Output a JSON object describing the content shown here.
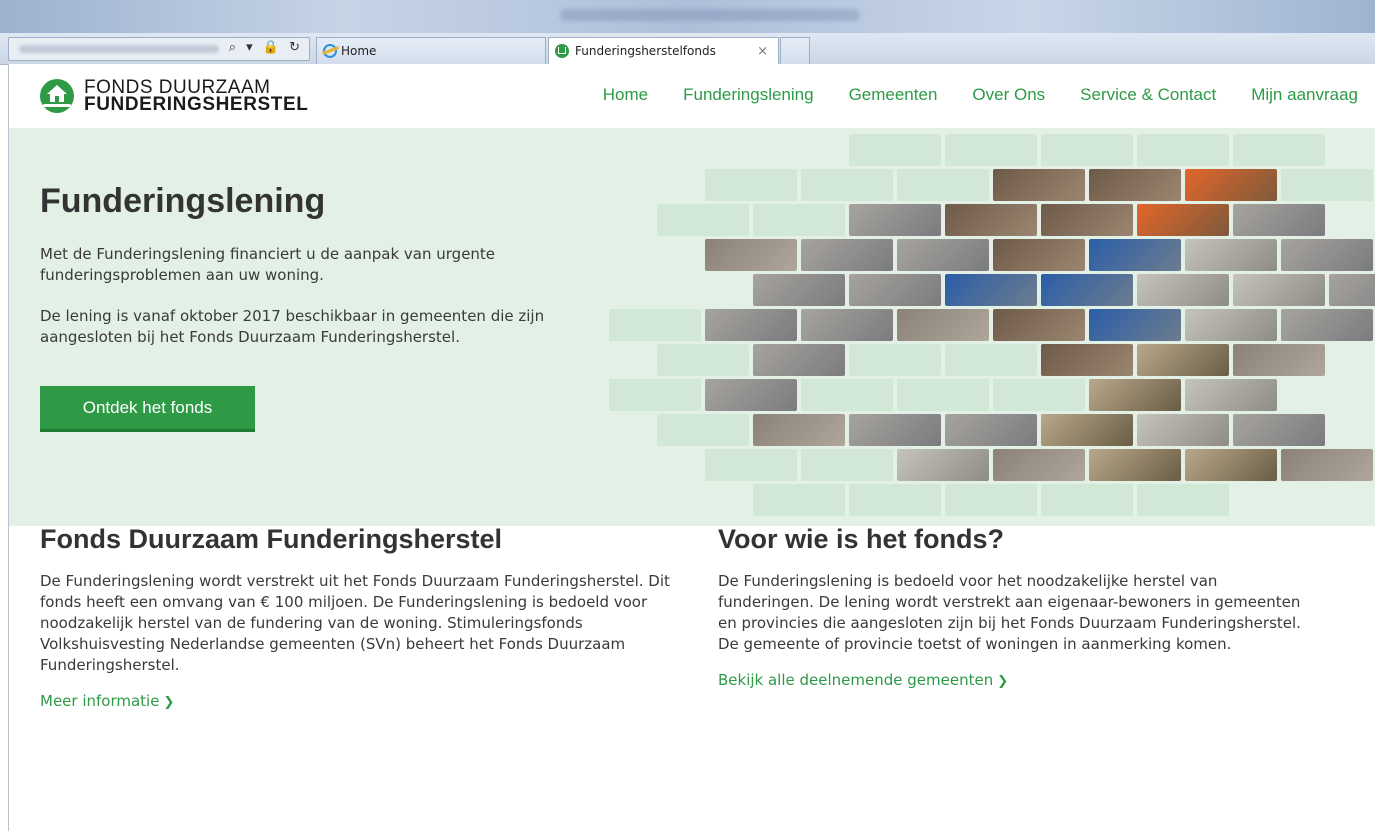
{
  "browser": {
    "tabs": [
      {
        "label": "Home",
        "icon": "ie-icon"
      },
      {
        "label": "Funderingsherstelfonds",
        "icon": "fdf-favicon"
      }
    ],
    "address_controls": "⌕ ▾ 🔒 ↻",
    "tab_close": "×"
  },
  "header": {
    "logo_line1": "FONDS DUURZAAM",
    "logo_line2": "FUNDERINGSHERSTEL",
    "nav": [
      "Home",
      "Funderingslening",
      "Gemeenten",
      "Over Ons",
      "Service & Contact",
      "Mijn aanvraag"
    ]
  },
  "hero": {
    "title": "Funderingslening",
    "paragraph1": "Met de Funderingslening financiert u de aanpak van urgente funderingsproblemen aan uw woning.",
    "paragraph2": "De lening is vanaf oktober 2017 beschikbaar in gemeenten die zijn aangesloten bij het Fonds Duurzaam Funderingsherstel.",
    "cta_label": "Ontdek het fonds"
  },
  "sections": [
    {
      "title": "Fonds Duurzaam Funderingsherstel",
      "body": "De Funderingslening wordt verstrekt uit het Fonds Duurzaam Funderingsherstel. Dit fonds heeft een omvang van € 100 miljoen. De Funderingslening is bedoeld voor noodzakelijk herstel van de fundering van de woning. Stimuleringsfonds Volkshuisvesting Nederlandse gemeenten (SVn) beheert het Fonds Duurzaam Funderingsherstel.",
      "link_label": "Meer informatie"
    },
    {
      "title": "Voor wie is het fonds?",
      "body": "De Funderingslening is bedoeld voor het noodzakelijke herstel van funderingen. De lening wordt verstrekt aan eigenaar-bewoners in gemeenten en provincies die aangesloten zijn bij het Fonds Duurzaam Funderingsherstel. De gemeente of provincie toetst of woningen in aanmerking komen.",
      "link_label": "Bekijk alle deelnemende gemeenten"
    }
  ],
  "colors": {
    "brand_green": "#2e9a46",
    "hero_background": "#e3f0e6"
  }
}
